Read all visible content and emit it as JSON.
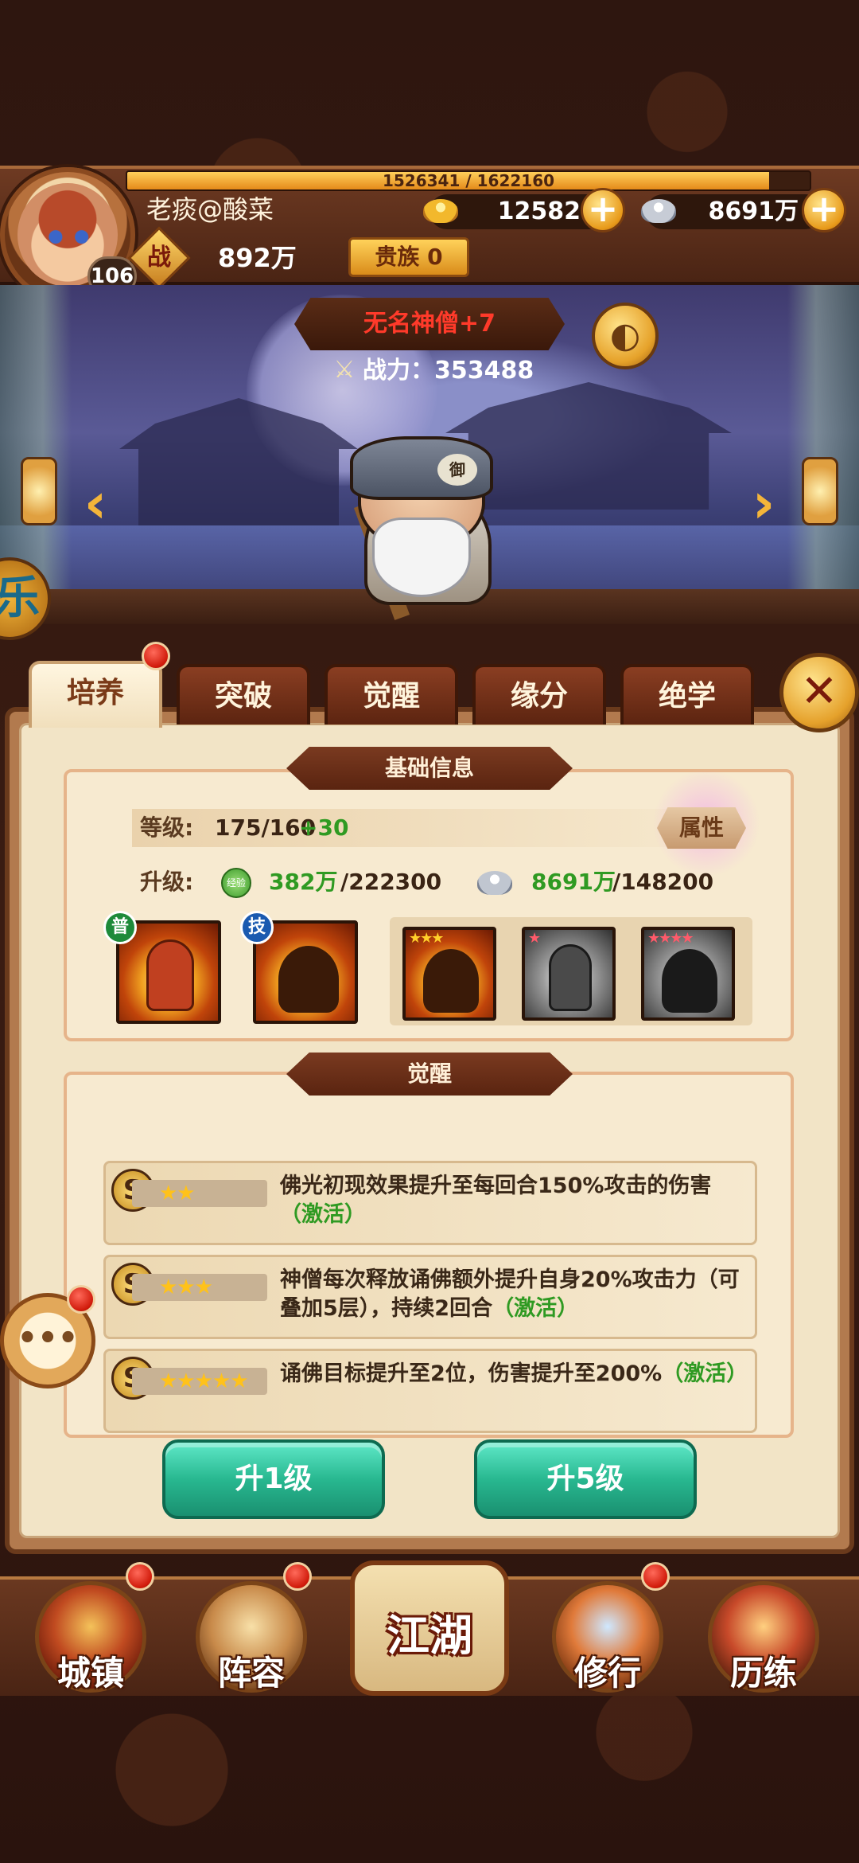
{
  "player": {
    "name": "老痰@酸菜",
    "level": "106",
    "exp_text": "1526341 / 1622160",
    "exp_fraction": 0.941,
    "gold": "12582",
    "silver": "8691万",
    "zhan_label": "战",
    "power": "892万",
    "noble": "贵族 0"
  },
  "hero": {
    "name": "无名神僧+7",
    "power_text": "战力：353488",
    "hat_mark": "御"
  },
  "side_event_char": "乐",
  "tabs": [
    "培养",
    "突破",
    "觉醒",
    "缘分",
    "绝学"
  ],
  "basic_info": {
    "header": "基础信息",
    "level_label": "等级:",
    "level_value": "175/160",
    "level_bonus": "+30",
    "attr_button": "属性",
    "upgrade_label": "升级:",
    "exp_pill_text": "经验",
    "exp_cost_have": "382万",
    "exp_cost_need": "/222300",
    "silver_cost_have": "8691万",
    "silver_cost_need": "/148200",
    "skill_badges": [
      "普",
      "技"
    ]
  },
  "awaken": {
    "header": "觉醒",
    "rows": [
      {
        "stars": "★★",
        "text": "佛光初现效果提升至每回合150%攻击的伤害",
        "tag": "（激活）"
      },
      {
        "stars": "★★★",
        "text": "神僧每次释放诵佛额外提升自身20%攻击力（可叠加5层），持续2回合",
        "tag": "（激活）"
      },
      {
        "stars": "★★★★★",
        "text": "诵佛目标提升至2位，伤害提升至200%",
        "tag": "（激活）"
      }
    ]
  },
  "buttons": {
    "up1": "升1级",
    "up5": "升5级"
  },
  "nav": {
    "town": "城镇",
    "team": "阵容",
    "jianghu": "江湖",
    "train": "修行",
    "experience": "历练"
  },
  "icons": {
    "plus": "+",
    "sound": "◐",
    "arrow_left": "‹",
    "arrow_right": "›",
    "close": "✕",
    "chat": "•••",
    "sword": "⚔",
    "s_mark": "S"
  },
  "colors": {
    "accent_gold": "#e89a1a",
    "activate_green": "#2f9a22",
    "hero_name_red": "#ff3a2a",
    "button_green": "#28b890"
  }
}
